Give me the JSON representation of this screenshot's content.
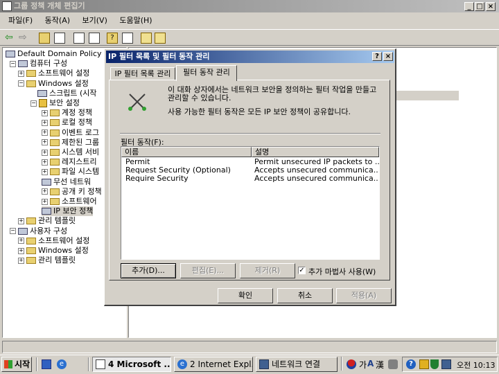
{
  "window": {
    "title": "그룹 정책 개체 편집기",
    "menu": [
      "파일(F)",
      "동작(A)",
      "보기(V)",
      "도움말(H)"
    ],
    "tree": [
      {
        "label": "Default Domain Policy [I",
        "icon": "policy-icon"
      },
      {
        "label": "컴퓨터 구성",
        "icon": "computer-icon"
      },
      {
        "label": "소프트웨어 설정",
        "icon": "folder-icon"
      },
      {
        "label": "Windows 설정",
        "icon": "folder-icon"
      },
      {
        "label": "스크립트 (시작",
        "icon": "script-icon"
      },
      {
        "label": "보안 설정",
        "icon": "security-icon"
      },
      {
        "label": "계정 정책",
        "icon": "folder-icon"
      },
      {
        "label": "로컬 정책",
        "icon": "folder-icon"
      },
      {
        "label": "이벤트 로그",
        "icon": "folder-icon"
      },
      {
        "label": "제한된 그룹",
        "icon": "folder-icon"
      },
      {
        "label": "시스템 서비",
        "icon": "folder-icon"
      },
      {
        "label": "레지스트리",
        "icon": "folder-icon"
      },
      {
        "label": "파일 시스템",
        "icon": "folder-icon"
      },
      {
        "label": "무선 네트워",
        "icon": "antenna-icon"
      },
      {
        "label": "공개 키 정책",
        "icon": "folder-icon"
      },
      {
        "label": "소프트웨어",
        "icon": "folder-icon"
      },
      {
        "label": "IP 보안 정책",
        "icon": "ipsec-icon"
      },
      {
        "label": "관리 템플릿",
        "icon": "folder-icon"
      },
      {
        "label": "사용자 구성",
        "icon": "user-icon"
      },
      {
        "label": "소프트웨어 설정",
        "icon": "folder-icon"
      },
      {
        "label": "Windows 설정",
        "icon": "folder-icon"
      },
      {
        "label": "관리 템플릿",
        "icon": "folder-icon"
      }
    ]
  },
  "dialog": {
    "title": "IP 필터 목록 및 필터 동작 관리",
    "help": "?",
    "close": "×",
    "tabs": [
      "IP 필터 목록 관리",
      "필터 동작 관리"
    ],
    "info1": "이 대화 상자에서는 네트워크 보안을 정의하는 필터 작업을 만들고 관리할 수 있습니다.",
    "info2": "사용 가능한 필터 동작은 모든 IP 보안 정책이 공유합니다.",
    "list_label": "필터 동작(F):",
    "columns": [
      "이름",
      "설명"
    ],
    "rows": [
      {
        "name": "Permit",
        "desc": "Permit unsecured IP packets to ..."
      },
      {
        "name": "Request Security (Optional)",
        "desc": "Accepts unsecured communica..."
      },
      {
        "name": "Require Security",
        "desc": "Accepts unsecured communica..."
      }
    ],
    "add": "추가(D)...",
    "edit": "편집(E)...",
    "remove": "제거(R)",
    "wizard_label": "추가 마법사 사용(W)",
    "wizard_checked": true,
    "ok": "확인",
    "cancel": "취소",
    "apply": "적용(A)"
  },
  "taskbar": {
    "start": "시작",
    "tasks": [
      "4 Microsoft ...",
      "2 Internet Expl...",
      "네트워크 연결"
    ],
    "ime": "가",
    "ime2": "A",
    "ime3": "漢",
    "clock": "오전 10:13"
  },
  "colors": {
    "title_active": "#0a246a",
    "title_gradient": "#a6caf0",
    "title_inactive": "#808080"
  }
}
